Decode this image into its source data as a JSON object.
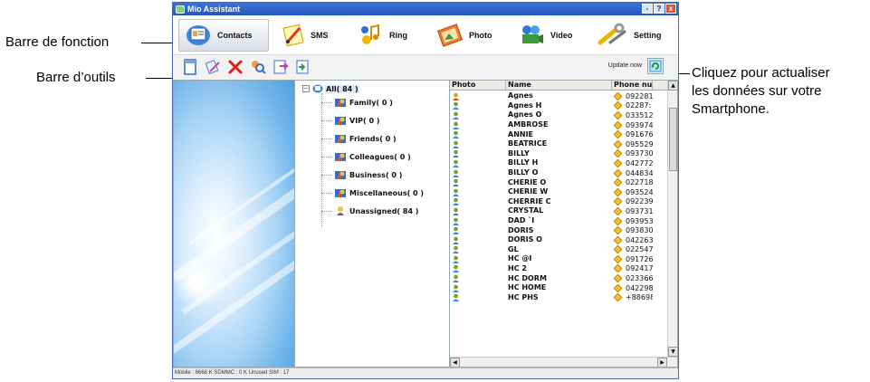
{
  "annotations": {
    "function_bar": "Barre de fonction",
    "toolbar": "Barre d’outils",
    "refresh_line1": "Cliquez pour actualiser",
    "refresh_line2": "les données sur votre",
    "refresh_line3": "Smartphone."
  },
  "window": {
    "title": "Mio Assistant",
    "controls": [
      "-",
      "?",
      "x"
    ]
  },
  "function_bar": {
    "items": [
      {
        "label": "Contacts",
        "icon": "contacts-icon",
        "active": true
      },
      {
        "label": "SMS",
        "icon": "sms-icon"
      },
      {
        "label": "Ring",
        "icon": "ring-icon"
      },
      {
        "label": "Photo",
        "icon": "photo-icon"
      },
      {
        "label": "Video",
        "icon": "video-icon"
      },
      {
        "label": "Setting",
        "icon": "setting-icon"
      }
    ]
  },
  "toolbar": {
    "buttons": [
      "new-contact-icon",
      "edit-contact-icon",
      "delete-icon",
      "search-contacts-icon",
      "import-icon",
      "export-icon"
    ],
    "update_label": "Update now",
    "update_icon": "refresh-icon"
  },
  "tree": {
    "root": "All( 84 )",
    "groups": [
      "Family( 0 )",
      "VIP( 0 )",
      "Friends( 0 )",
      "Colleagues( 0 )",
      "Business( 0 )",
      "Miscellaneous( 0 )",
      "Unassigned( 84 )"
    ]
  },
  "list": {
    "headers": {
      "photo": "Photo",
      "name": "Name",
      "phone": "Phone nur"
    },
    "rows": [
      {
        "name": "Agnes",
        "phone": "092281"
      },
      {
        "name": "Agnes H",
        "phone": "02287:"
      },
      {
        "name": "Agnes O",
        "phone": "033512"
      },
      {
        "name": "AMBROSE",
        "phone": "093974"
      },
      {
        "name": "ANNIE",
        "phone": "091676"
      },
      {
        "name": "BEATRICE",
        "phone": "095529"
      },
      {
        "name": "BILLY",
        "phone": "093730"
      },
      {
        "name": "BILLY H",
        "phone": "042772"
      },
      {
        "name": "BILLY O",
        "phone": "044834"
      },
      {
        "name": "CHERIE O",
        "phone": "022718"
      },
      {
        "name": "CHERIE W",
        "phone": "093524"
      },
      {
        "name": "CHERRIE C",
        "phone": "092239"
      },
      {
        "name": "CRYSTAL",
        "phone": "093731"
      },
      {
        "name": "DAD  `I",
        "phone": "093953"
      },
      {
        "name": "DORIS",
        "phone": "093830"
      },
      {
        "name": "DORIS O",
        "phone": "042263"
      },
      {
        "name": "GL",
        "phone": "022547"
      },
      {
        "name": "HC    @I",
        "phone": "091726"
      },
      {
        "name": "HC 2",
        "phone": "092417"
      },
      {
        "name": "HC DORM",
        "phone": "023366"
      },
      {
        "name": "HC HOME",
        "phone": "042298"
      },
      {
        "name": "HC PHS",
        "phone": "+88698"
      }
    ]
  },
  "status": "Mobile : 8668 K  SDMMC : 0 K  Unused SIM : 17"
}
